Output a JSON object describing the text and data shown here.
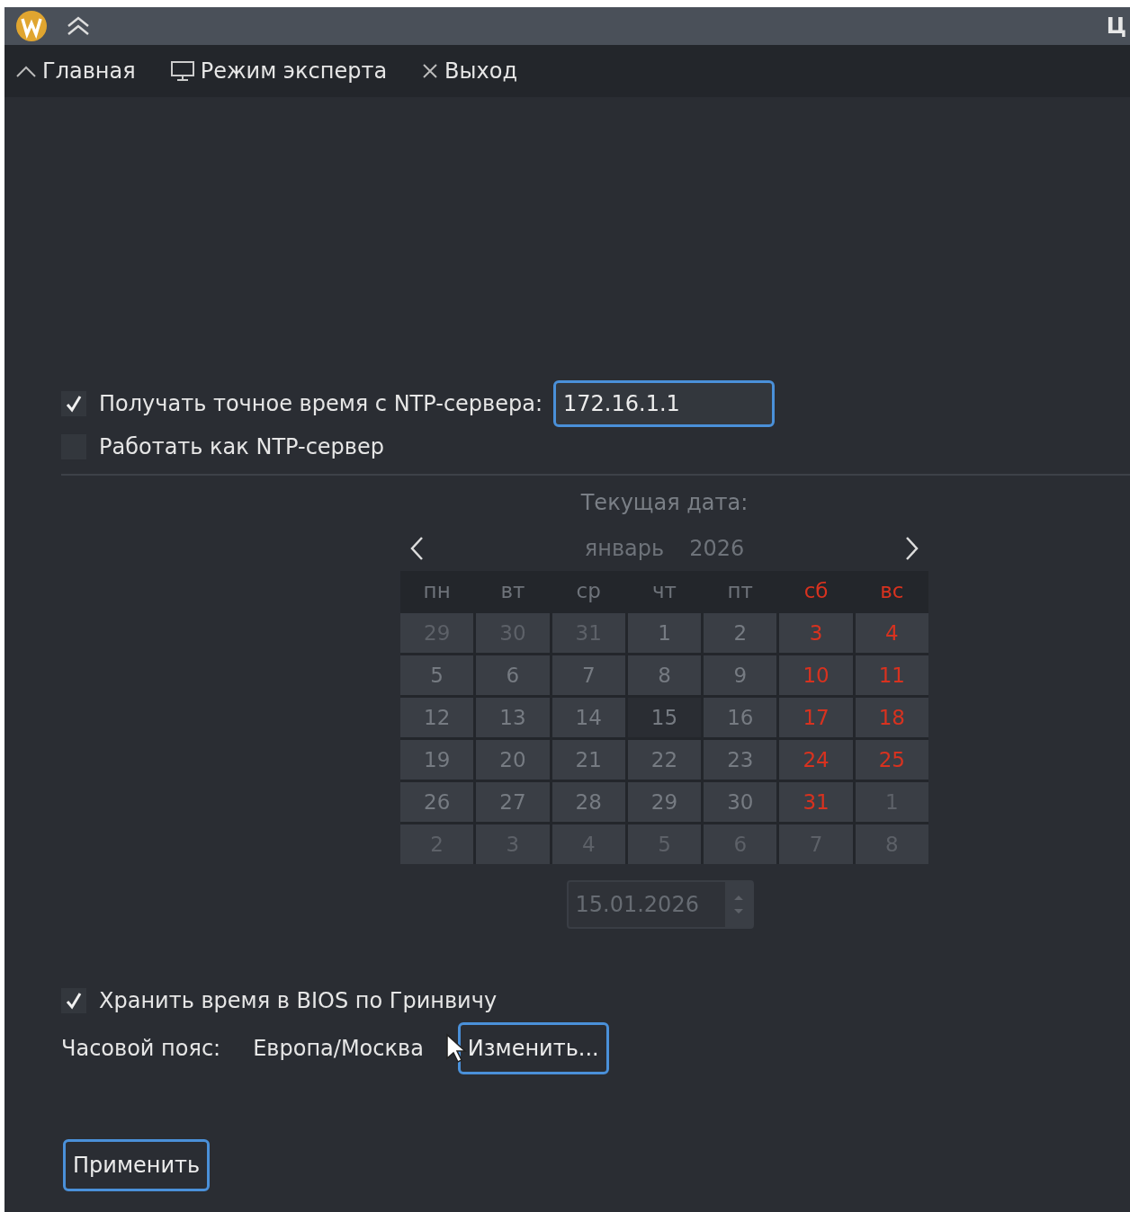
{
  "title_bar": {
    "title": "Ц"
  },
  "toolbar": [
    {
      "kind": "home",
      "label": "Главная"
    },
    {
      "kind": "expert",
      "label": "Режим эксперта"
    },
    {
      "kind": "exit",
      "label": "Выход"
    }
  ],
  "ntp": {
    "label": "Получать точное время с NTP-сервера:",
    "checked": true,
    "server": "172.16.1.1"
  },
  "ntp_server": {
    "label": "Работать как NTP-сервер",
    "checked": false
  },
  "date": {
    "label": "Текущая дата:",
    "month": "январь",
    "year": "2026",
    "disabled": true,
    "weekdays": [
      {
        "label": "пн",
        "weekend": false
      },
      {
        "label": "вт",
        "weekend": false
      },
      {
        "label": "ср",
        "weekend": false
      },
      {
        "label": "чт",
        "weekend": false
      },
      {
        "label": "пт",
        "weekend": false
      },
      {
        "label": "сб",
        "weekend": true
      },
      {
        "label": "вс",
        "weekend": true
      }
    ],
    "weeks": [
      [
        {
          "day": "29",
          "outside": true,
          "selected": false
        },
        {
          "day": "30",
          "outside": true,
          "selected": false
        },
        {
          "day": "31",
          "outside": true,
          "selected": false
        },
        {
          "day": "1",
          "outside": false,
          "selected": false
        },
        {
          "day": "2",
          "outside": false,
          "selected": false
        },
        {
          "day": "3",
          "outside": false,
          "selected": false
        },
        {
          "day": "4",
          "outside": false,
          "selected": false
        }
      ],
      [
        {
          "day": "5",
          "outside": false,
          "selected": false
        },
        {
          "day": "6",
          "outside": false,
          "selected": false
        },
        {
          "day": "7",
          "outside": false,
          "selected": false
        },
        {
          "day": "8",
          "outside": false,
          "selected": false
        },
        {
          "day": "9",
          "outside": false,
          "selected": false
        },
        {
          "day": "10",
          "outside": false,
          "selected": false
        },
        {
          "day": "11",
          "outside": false,
          "selected": false
        }
      ],
      [
        {
          "day": "12",
          "outside": false,
          "selected": false
        },
        {
          "day": "13",
          "outside": false,
          "selected": false
        },
        {
          "day": "14",
          "outside": false,
          "selected": false
        },
        {
          "day": "15",
          "outside": false,
          "selected": true
        },
        {
          "day": "16",
          "outside": false,
          "selected": false
        },
        {
          "day": "17",
          "outside": false,
          "selected": false
        },
        {
          "day": "18",
          "outside": false,
          "selected": false
        }
      ],
      [
        {
          "day": "19",
          "outside": false,
          "selected": false
        },
        {
          "day": "20",
          "outside": false,
          "selected": false
        },
        {
          "day": "21",
          "outside": false,
          "selected": false
        },
        {
          "day": "22",
          "outside": false,
          "selected": false
        },
        {
          "day": "23",
          "outside": false,
          "selected": false
        },
        {
          "day": "24",
          "outside": false,
          "selected": false
        },
        {
          "day": "25",
          "outside": false,
          "selected": false
        }
      ],
      [
        {
          "day": "26",
          "outside": false,
          "selected": false
        },
        {
          "day": "27",
          "outside": false,
          "selected": false
        },
        {
          "day": "28",
          "outside": false,
          "selected": false
        },
        {
          "day": "29",
          "outside": false,
          "selected": false
        },
        {
          "day": "30",
          "outside": false,
          "selected": false
        },
        {
          "day": "31",
          "outside": false,
          "selected": false
        },
        {
          "day": "1",
          "outside": true,
          "selected": false
        }
      ],
      [
        {
          "day": "2",
          "outside": true,
          "selected": false
        },
        {
          "day": "3",
          "outside": true,
          "selected": false
        },
        {
          "day": "4",
          "outside": true,
          "selected": false
        },
        {
          "day": "5",
          "outside": true,
          "selected": false
        },
        {
          "day": "6",
          "outside": true,
          "selected": false
        },
        {
          "day": "7",
          "outside": true,
          "selected": false
        },
        {
          "day": "8",
          "outside": true,
          "selected": false
        }
      ]
    ],
    "value": "15.01.2026"
  },
  "bios": {
    "label": "Хранить время в BIOS по Гринвичу",
    "checked": true
  },
  "timezone": {
    "label": "Часовой пояс:",
    "value": "Европа/Москва",
    "button": "Изменить..."
  },
  "apply": "Применить"
}
